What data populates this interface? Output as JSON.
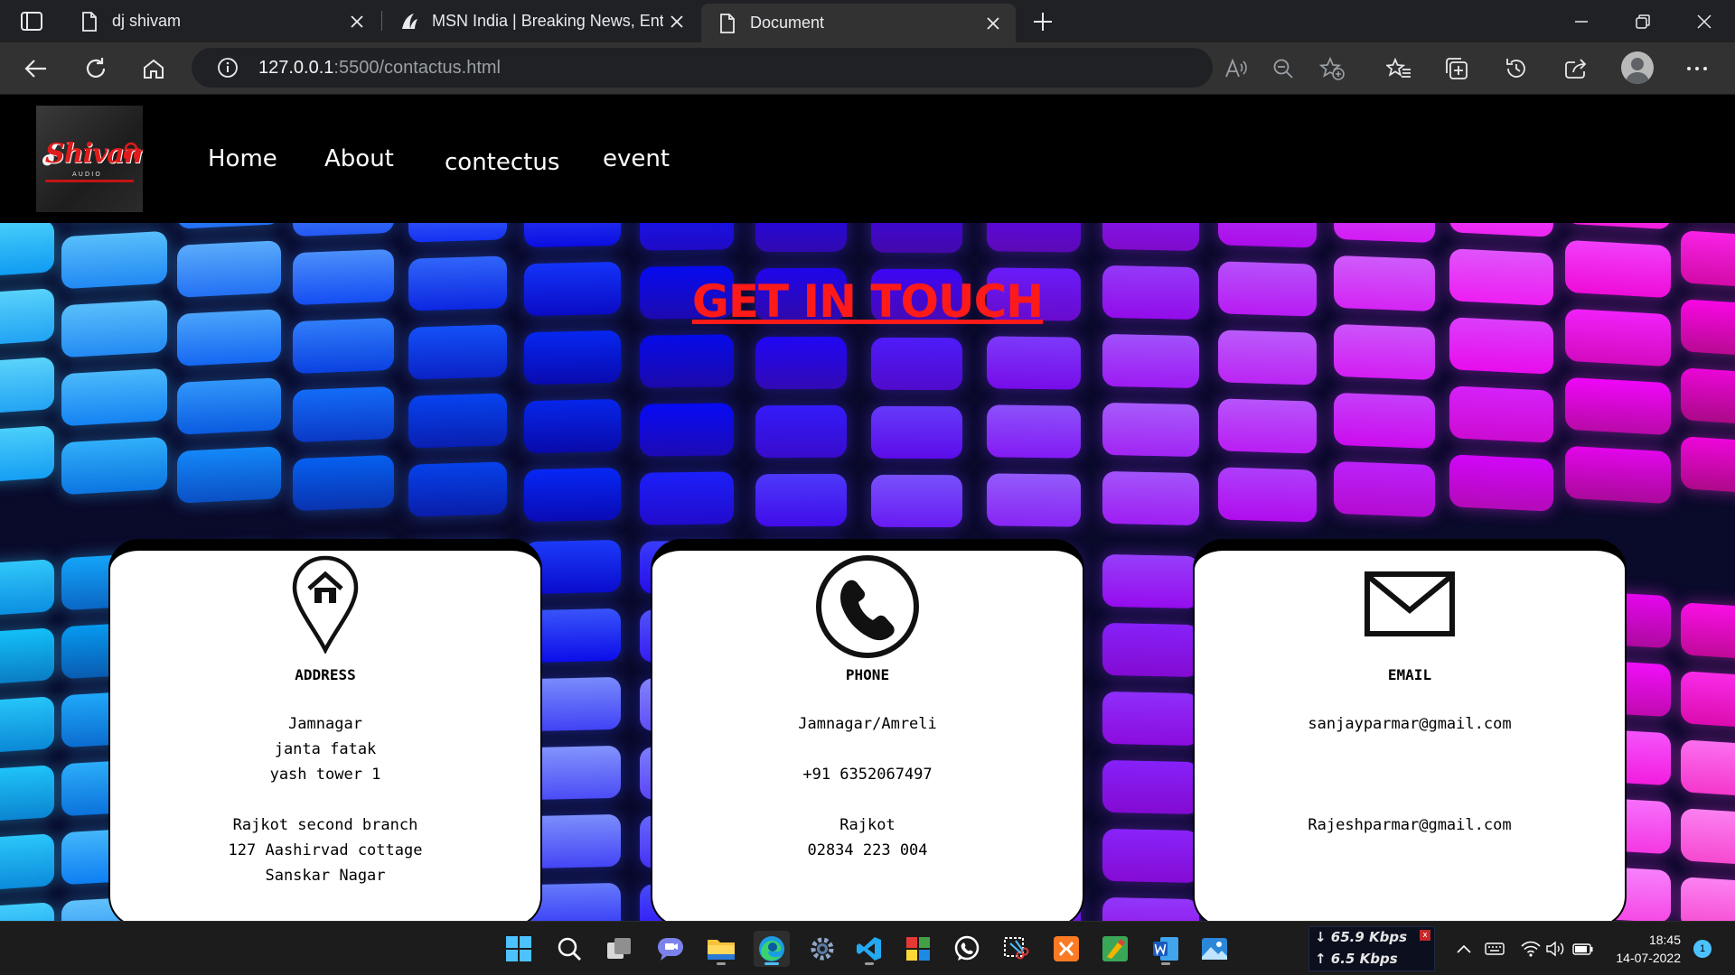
{
  "browser": {
    "tabs": [
      {
        "title": "dj shivam",
        "icon": "document-icon"
      },
      {
        "title": "MSN India | Breaking News, Ente",
        "icon": "msn-icon"
      },
      {
        "title": "Document",
        "icon": "document-icon"
      }
    ],
    "url_host": "127.0.0.1",
    "url_rest": ":5500/contactus.html"
  },
  "site": {
    "logo_text": "Shivam",
    "logo_sub": "AUDIO",
    "nav": [
      "Home",
      "About",
      "contectus",
      "event"
    ],
    "heading": "GET IN TOUCH",
    "heading_color": "#ff1a1a",
    "cards": [
      {
        "icon": "location-pin-icon",
        "title": "ADDRESS",
        "lines": [
          "Jamnagar",
          "janta fatak",
          "yash tower 1",
          "",
          "Rajkot second branch",
          "127 Aashirvad cottage",
          "Sanskar Nagar"
        ]
      },
      {
        "icon": "phone-icon",
        "title": "PHONE",
        "lines": [
          "Jamnagar/Amreli",
          "",
          "+91 6352067497",
          "",
          "Rajkot",
          "02834 223 004"
        ]
      },
      {
        "icon": "mail-icon",
        "title": "EMAIL",
        "lines": [
          "sanjayparmar@gmail.com",
          "",
          "",
          "",
          "Rajeshparmar@gmail.com"
        ]
      }
    ]
  },
  "taskbar": {
    "net_down": "65.9 Kbps",
    "net_up": "6.5 Kbps",
    "net_close": "x",
    "time": "18:45",
    "date": "14-07-2022",
    "notifications": "1"
  }
}
